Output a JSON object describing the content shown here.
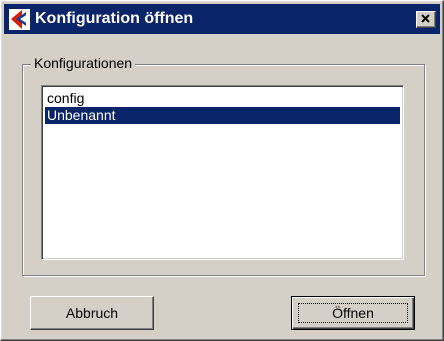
{
  "window": {
    "title": "Konfiguration öffnen",
    "titlebar_color": "#0a246a",
    "background_color": "#d4d0c8"
  },
  "icons": {
    "app": "app-logo-icon",
    "close": "close-icon"
  },
  "group": {
    "legend": "Konfigurationen"
  },
  "list": {
    "items": [
      {
        "label": "config",
        "selected": false
      },
      {
        "label": "Unbenannt",
        "selected": true
      }
    ],
    "selection_color": "#0a246a"
  },
  "buttons": {
    "cancel_label": "Abbruch",
    "open_label": "Öffnen"
  }
}
